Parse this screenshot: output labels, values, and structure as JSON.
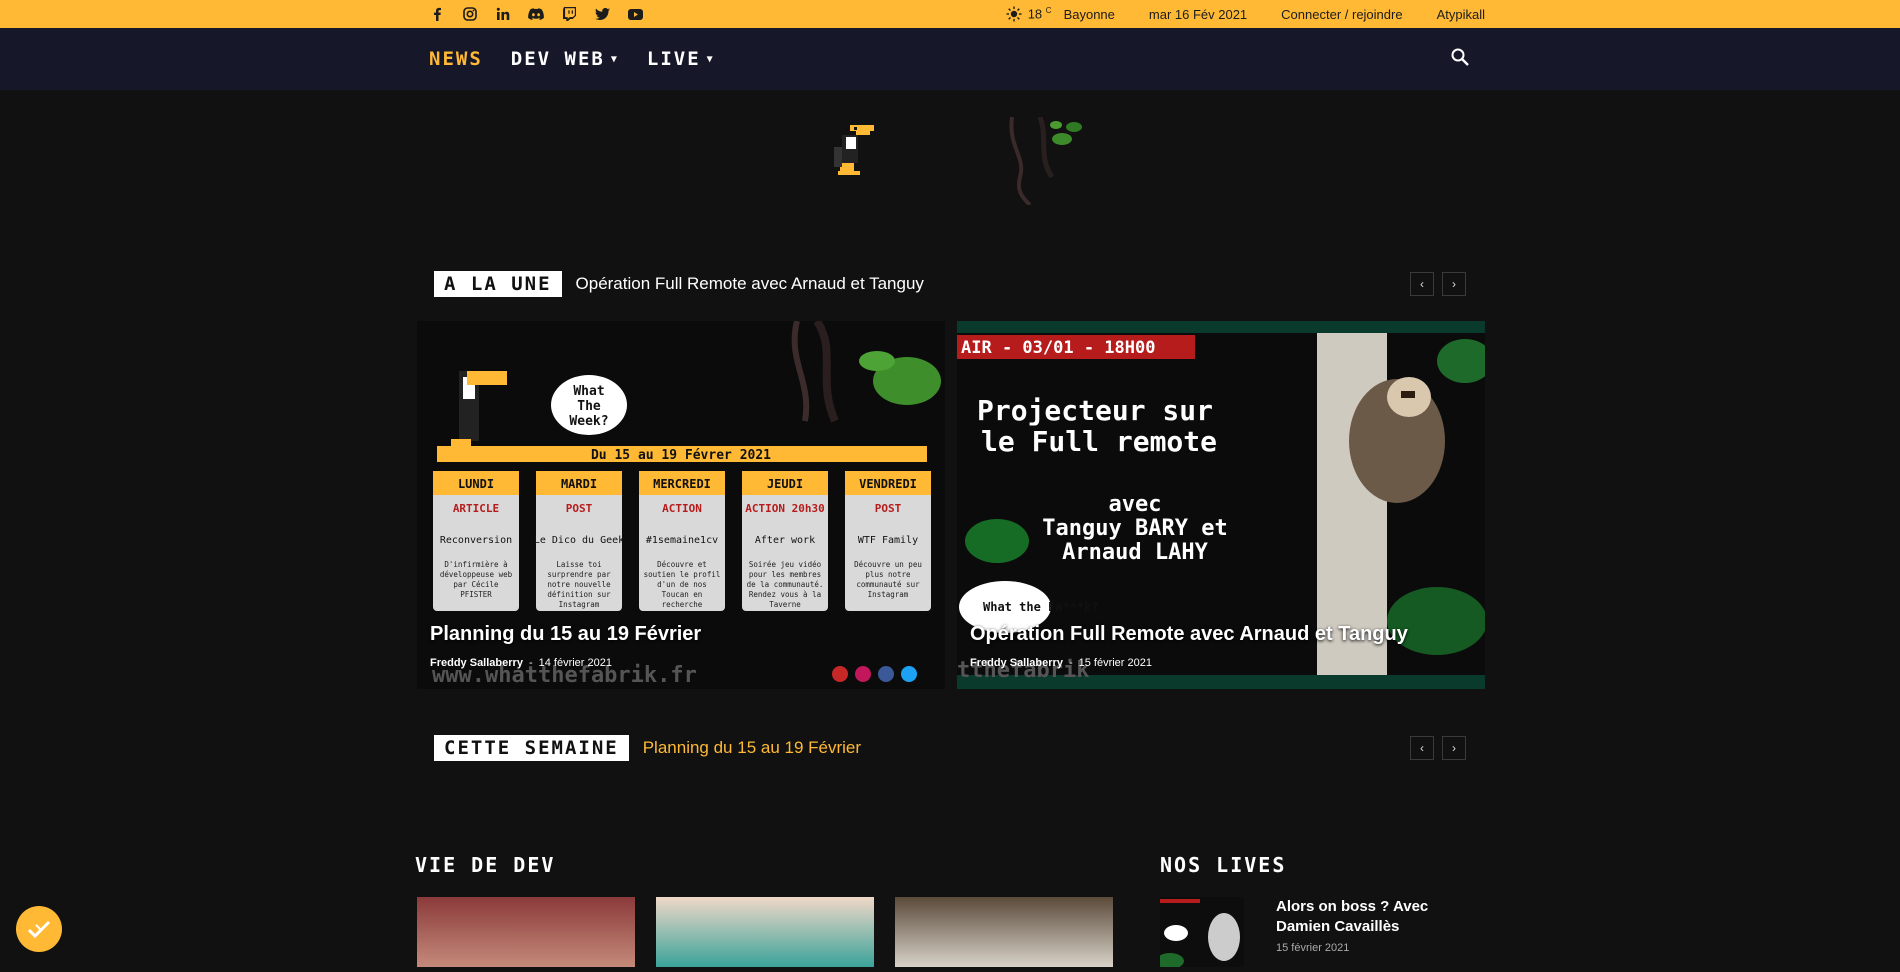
{
  "topbar": {
    "socials": [
      "facebook-icon",
      "instagram-icon",
      "linkedin-icon",
      "discord-icon",
      "twitch-icon",
      "twitter-icon",
      "youtube-icon"
    ],
    "weather": {
      "temp": "18",
      "unit": "C",
      "city": "Bayonne"
    },
    "date": "mar 16 Fév 2021",
    "login": "Connecter / rejoindre",
    "brand": "Atypikall"
  },
  "nav": {
    "items": [
      {
        "label": "NEWS",
        "active": true
      },
      {
        "label": "DEV WEB"
      },
      {
        "label": "LIVE"
      }
    ]
  },
  "featured": {
    "tag": "A LA UNE",
    "ticker": "Opération Full Remote avec Arnaud et Tanguy"
  },
  "cards": [
    {
      "title": "Planning du 15 au 19 Février",
      "author": "Freddy Sallaberry",
      "date": "14 février 2021",
      "image": {
        "bubble": [
          "What",
          "The",
          "Week?"
        ],
        "banner": "Du 15 au 19 Févrer 2021",
        "days": [
          {
            "day": "LUNDI",
            "type": "ARTICLE",
            "title": "Reconversion",
            "desc": "D'infirmière à développeuse web par Cécile PFISTER"
          },
          {
            "day": "MARDI",
            "type": "POST",
            "title": "Le Dico du Geek",
            "desc": "Laisse toi surprendre par notre nouvelle définition sur Instagram"
          },
          {
            "day": "MERCREDI",
            "type": "ACTION",
            "title": "#1semaine1cv",
            "desc": "Découvre et soutien le profil d'un de nos Toucan en recherche d'emploi sur Linkedin"
          },
          {
            "day": "JEUDI",
            "type": "ACTION 20h30",
            "title": "After work",
            "desc": "Soirée jeu vidéo pour les membres de la communauté. Rendez vous à la Taverne"
          },
          {
            "day": "VENDREDI",
            "type": "POST",
            "title": "WTF Family",
            "desc": "Découvre un peu plus notre communauté sur Instagram"
          }
        ],
        "footer_url": "www.whatthefabrik.fr"
      }
    },
    {
      "title": "Opération Full Remote avec Arnaud et Tanguy",
      "author": "Freddy Sallaberry",
      "date": "15 février 2021",
      "image": {
        "header": "AIR - 03/01 - 18H00",
        "line1": "Projecteur sur",
        "line2": "le Full remote",
        "line3": "avec",
        "line4": "Tanguy BARY et",
        "line5": "Arnaud LAHY",
        "bubble": "What the Fa***k?",
        "footer_url": "tthefabrik"
      }
    }
  ],
  "week": {
    "tag": "CETTE SEMAINE",
    "ticker": "Planning du 15 au 19 Février"
  },
  "sections": {
    "vie_de_dev": "VIE DE DEV",
    "nos_lives": "NOS LIVES"
  },
  "live": {
    "title": "Alors on boss ? Avec Damien Cavaillès",
    "date": "15 février 2021"
  },
  "colors": {
    "accent": "#ffb935",
    "nav_bg": "#17172a",
    "page_bg": "#111111"
  }
}
